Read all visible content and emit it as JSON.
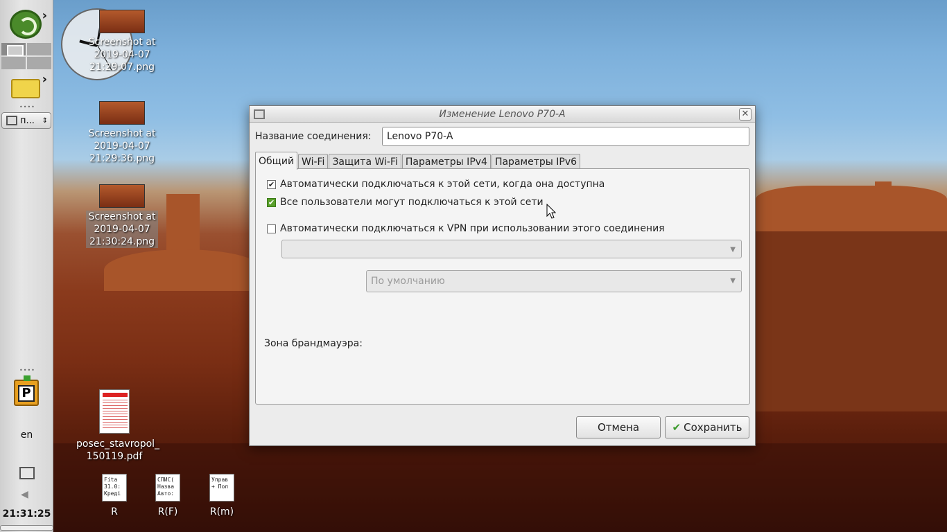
{
  "panel": {
    "task_label": "п...",
    "lang": "en",
    "time": "21:31:25"
  },
  "desktop": {
    "icons": [
      {
        "label": "Screenshot at\n2019-04-07\n21:29:07.png"
      },
      {
        "label": "Screenshot at\n2019-04-07\n21:29:36.png"
      },
      {
        "label": "Screenshot at\n2019-04-07\n21:30:24.png"
      },
      {
        "label": "posec_stavropol_\n150119.pdf"
      },
      {
        "label": "R",
        "preview": "Fita\n31.0:\nКреді"
      },
      {
        "label": "R(F)",
        "preview": "СПИС(\nНазва\nАвто:"
      },
      {
        "label": "R(m)",
        "preview": "Управ\n+ Пол"
      }
    ]
  },
  "dialog": {
    "title": "Изменение Lenovo P70-A",
    "name_label": "Название соединения:",
    "name_value": "Lenovo P70-A",
    "tabs": [
      "Общий",
      "Wi-Fi",
      "Защита Wi-Fi",
      "Параметры IPv4",
      "Параметры IPv6"
    ],
    "auto_connect": {
      "label": "Автоматически подключаться к этой сети, когда она доступна",
      "checked": true
    },
    "all_users": {
      "label": "Все пользователи могут подключаться к этой сети",
      "checked": true
    },
    "auto_vpn": {
      "label": "Автоматически подключаться к VPN при использовании этого соединения",
      "checked": false
    },
    "vpn_select": "",
    "firewall_label": "Зона брандмауэра:",
    "firewall_value": "По умолчанию",
    "cancel": "Отмена",
    "save": "Сохранить"
  }
}
